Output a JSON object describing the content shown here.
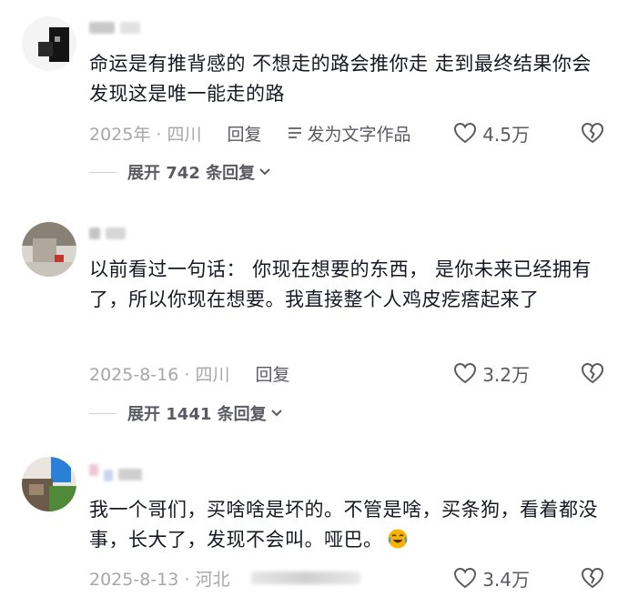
{
  "comments": [
    {
      "text": "命运是有推背感的 不想走的路会推你走 走到最终结果你会发现这是唯一能走的路",
      "date_location": "2025年 · 四川",
      "reply_label": "回复",
      "share_label": "发为文字作品",
      "likes": "4.5万",
      "expand_label": "展开 742 条回复"
    },
    {
      "text": "以前看过一句话： 你现在想要的东西， 是你未来已经拥有了，所以你现在想要。我直接整个人鸡皮疙瘩起来了",
      "date_location": "2025-8-16 · 四川",
      "reply_label": "回复",
      "likes": "3.2万",
      "expand_label": "展开 1441 条回复"
    },
    {
      "text": "我一个哥们，买啥啥是坏的。不管是啥，买条狗，看着都没事，长大了，发现不会叫。哑巴。",
      "date_location": "2025-8-13 · 河北",
      "likes": "3.4万"
    }
  ],
  "icons": {
    "like": "heart-outline-icon",
    "dislike": "broken-heart-icon",
    "share": "text-lines-icon",
    "expand": "chevron-down-icon",
    "emoji": "crying-laughing-emoji-icon"
  },
  "colors": {
    "text": "#161823",
    "meta": "#a7a7ab",
    "action": "#5a5a62",
    "emoji": "#f6b400"
  }
}
